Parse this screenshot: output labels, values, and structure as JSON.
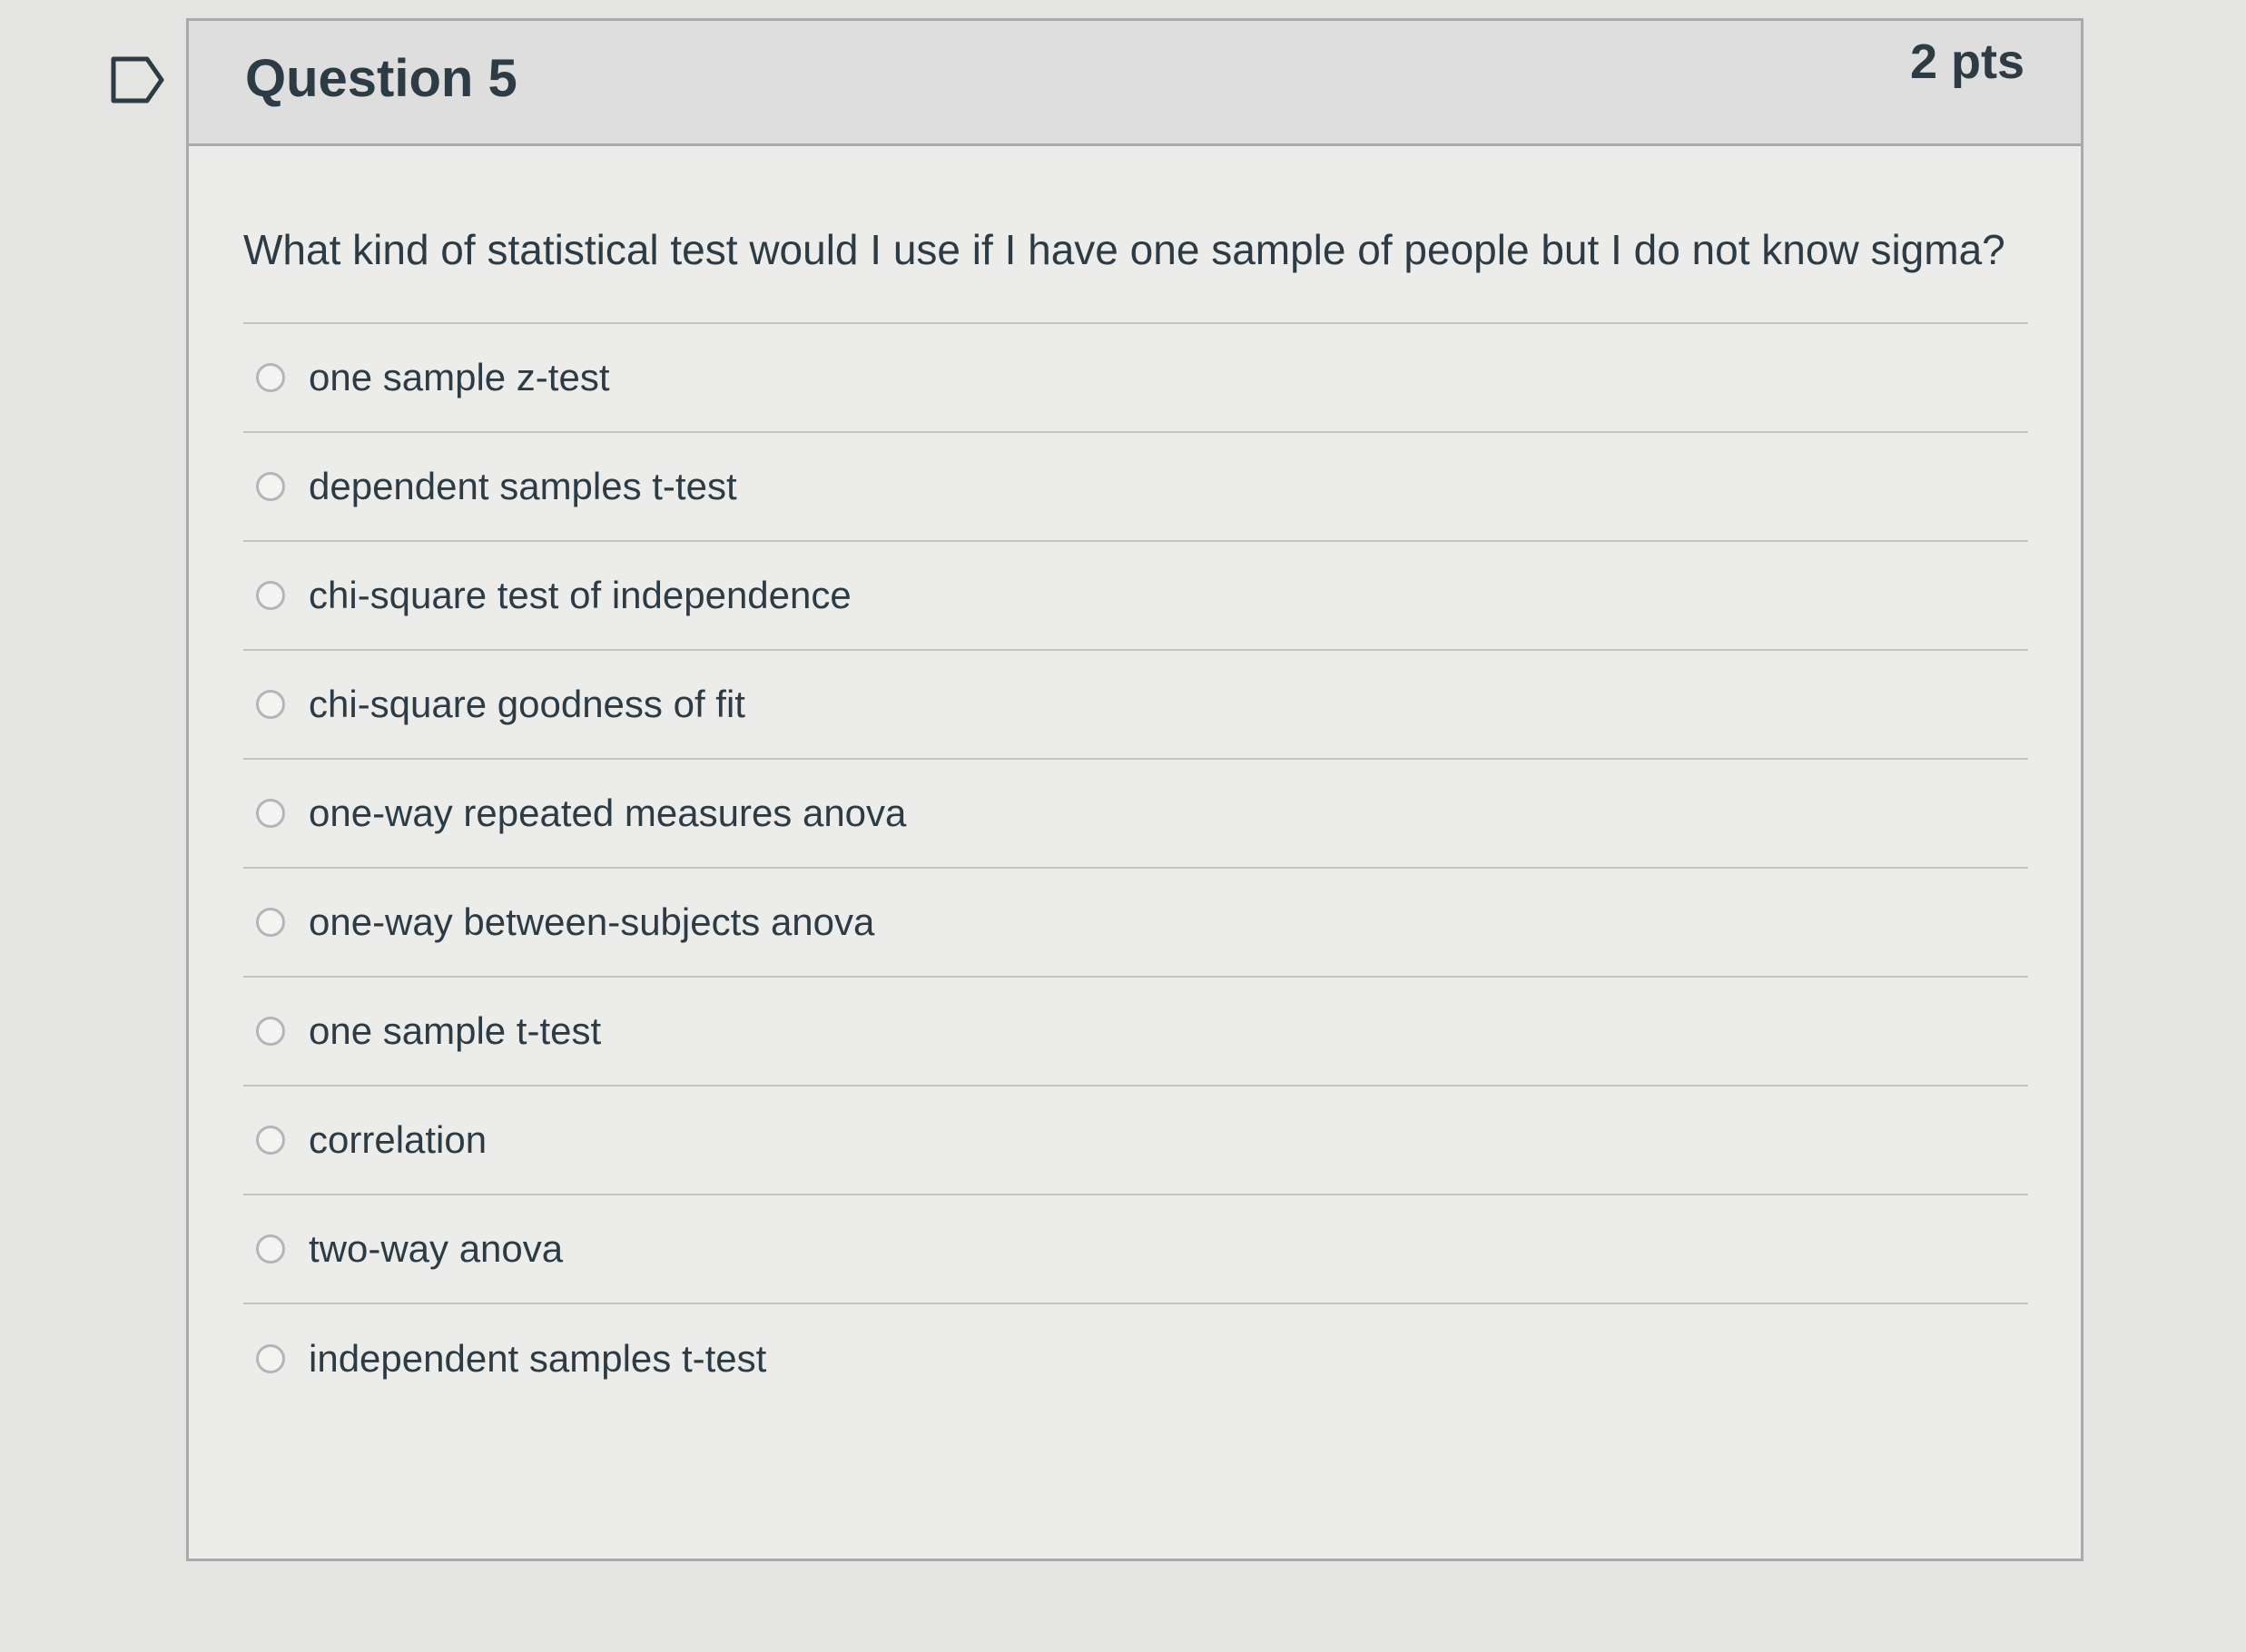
{
  "question": {
    "title": "Question 5",
    "points": "2 pts",
    "text": "What kind of statistical test would I use if I have one sample of people but I do not know sigma?",
    "flag_icon": "bookmark-flag-outline",
    "answers": [
      {
        "label": "one sample z-test",
        "selected": false
      },
      {
        "label": "dependent samples t-test",
        "selected": false
      },
      {
        "label": "chi-square test of independence",
        "selected": false
      },
      {
        "label": "chi-square goodness of fit",
        "selected": false
      },
      {
        "label": "one-way repeated measures anova",
        "selected": false
      },
      {
        "label": "one-way between-subjects anova",
        "selected": false
      },
      {
        "label": "one sample t-test",
        "selected": false
      },
      {
        "label": "correlation",
        "selected": false
      },
      {
        "label": "two-way anova",
        "selected": false
      },
      {
        "label": "independent samples t-test",
        "selected": false
      }
    ]
  },
  "colors": {
    "text": "#2d3b45",
    "border": "#a8aaab",
    "header_bg": "#dddedd",
    "card_bg": "#ecedeb"
  }
}
